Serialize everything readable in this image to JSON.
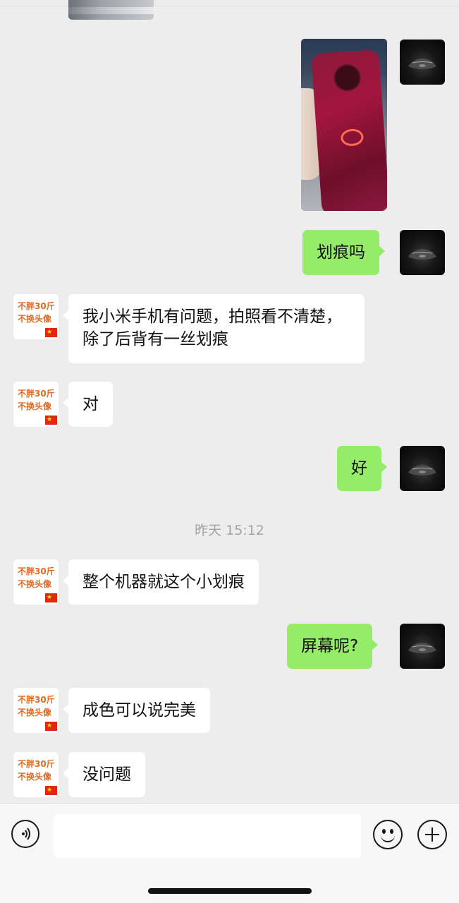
{
  "app": {
    "accent_color": "#95ec69",
    "incoming_bubble_color": "#ffffff",
    "background_color": "#ededed"
  },
  "contact": {
    "avatar_line1": "不胖30斤",
    "avatar_line2": "不换头像",
    "avatar_flag": "cn-flag-icon"
  },
  "self": {
    "avatar_icon": "car-icon"
  },
  "messages": [
    {
      "side": "right",
      "type": "image",
      "description_icon": "phone-photo"
    },
    {
      "side": "right",
      "type": "text",
      "text": "划痕吗"
    },
    {
      "side": "left",
      "type": "text",
      "text": "我小米手机有问题，拍照看不清楚，除了后背有一丝划痕"
    },
    {
      "side": "left",
      "type": "text",
      "text": "对"
    },
    {
      "side": "right",
      "type": "text",
      "text": "好"
    },
    {
      "side": "left",
      "type": "text",
      "text": "整个机器就这个小划痕"
    },
    {
      "side": "right",
      "type": "text",
      "text": "屏幕呢?"
    },
    {
      "side": "left",
      "type": "text",
      "text": "成色可以说完美"
    },
    {
      "side": "left",
      "type": "text",
      "text": "没问题"
    }
  ],
  "timestamp": "昨天 15:12",
  "input_bar": {
    "voice_icon": "voice-icon",
    "input_value": "",
    "emoji_icon": "emoji-icon",
    "plus_icon": "plus-icon"
  }
}
